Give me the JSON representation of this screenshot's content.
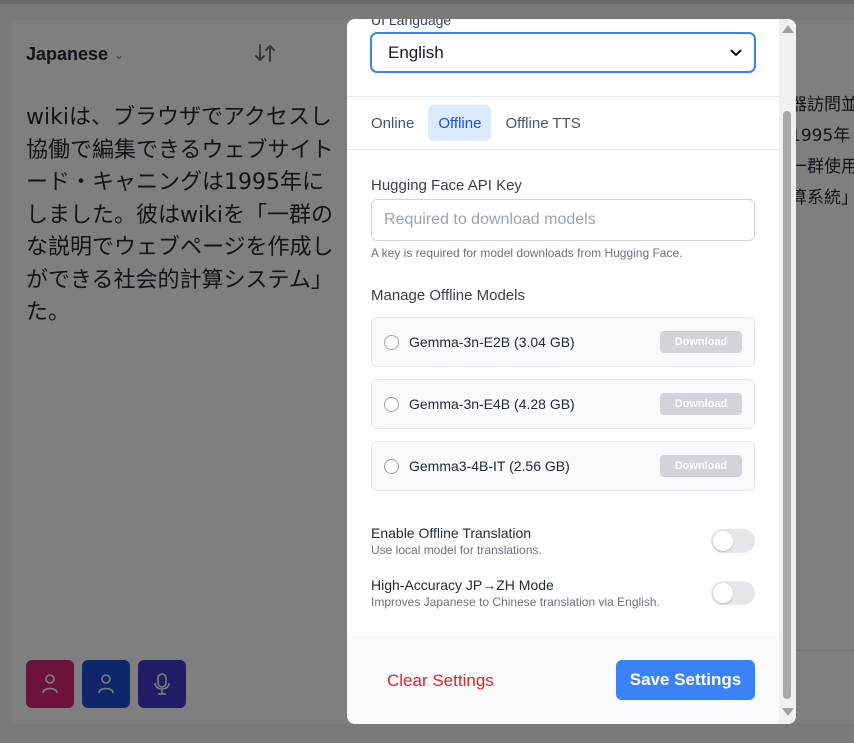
{
  "background": {
    "source_language": "Japanese",
    "source_text": "wikiは、ブラウザでアクセスし\n協働で編集できるウェブサイト\nード・キャニングは1995年に\nしました。彼はwikiを「一群の\nな説明でウェブページを作成し\nができる社会的計算システム」\nた。",
    "target_text": "器訪問並\n1995年\n一群使用\n算系統」",
    "bottom_buttons": [
      "person-icon",
      "person-icon",
      "microphone-icon"
    ]
  },
  "modal": {
    "ui_language_label": "UI Language",
    "ui_language_value": "English",
    "tabs": [
      {
        "label": "Online",
        "active": false
      },
      {
        "label": "Offline",
        "active": true
      },
      {
        "label": "Offline TTS",
        "active": false
      }
    ],
    "api_key": {
      "label": "Hugging Face API Key",
      "placeholder": "Required to download models",
      "help": "A key is required for model downloads from Hugging Face."
    },
    "models_label": "Manage Offline Models",
    "models": [
      {
        "name": "Gemma-3n-E2B (3.04 GB)",
        "action": "Download"
      },
      {
        "name": "Gemma-3n-E4B (4.28 GB)",
        "action": "Download"
      },
      {
        "name": "Gemma3-4B-IT (2.56 GB)",
        "action": "Download"
      }
    ],
    "toggles": [
      {
        "title": "Enable Offline Translation",
        "desc": "Use local model for translations.",
        "on": false
      },
      {
        "title": "High-Accuracy JP→ZH Mode",
        "desc": "Improves Japanese to Chinese translation via English.",
        "on": false
      }
    ],
    "clear_label": "Clear Settings",
    "save_label": "Save Settings"
  },
  "colors": {
    "accent": "#3b82f6",
    "danger": "#dc2626",
    "active_tab_bg": "#dbeafe"
  }
}
